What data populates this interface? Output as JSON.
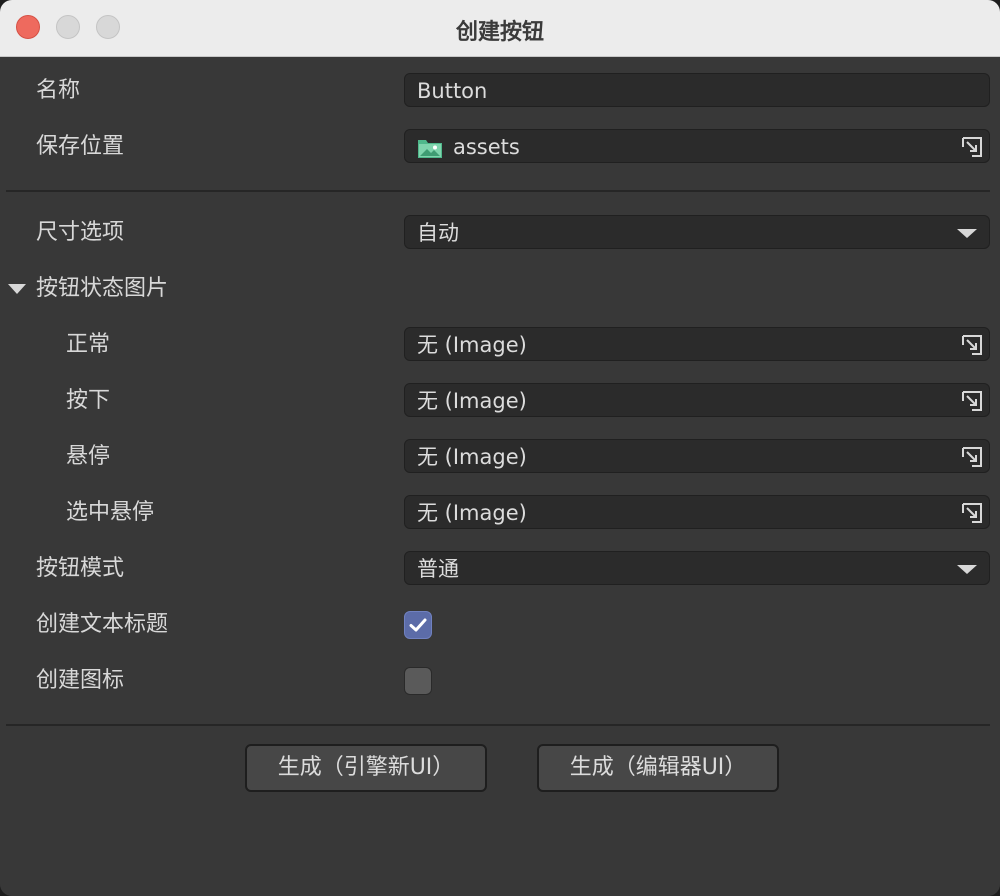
{
  "window": {
    "title": "创建按钮"
  },
  "form": {
    "name": {
      "label": "名称",
      "value": "Button"
    },
    "save_location": {
      "label": "保存位置",
      "value": "assets",
      "icon": "folder-icon"
    },
    "size_option": {
      "label": "尺寸选项",
      "value": "自动"
    },
    "state_images": {
      "label": "按钮状态图片",
      "normal": {
        "label": "正常",
        "value": "无 (Image)"
      },
      "pressed": {
        "label": "按下",
        "value": "无 (Image)"
      },
      "hover": {
        "label": "悬停",
        "value": "无 (Image)"
      },
      "selected_hover": {
        "label": "选中悬停",
        "value": "无 (Image)"
      }
    },
    "button_mode": {
      "label": "按钮模式",
      "value": "普通"
    },
    "create_text_title": {
      "label": "创建文本标题",
      "checked": true
    },
    "create_icon": {
      "label": "创建图标",
      "checked": false
    }
  },
  "actions": {
    "generate_engine_ui": "生成（引擎新UI）",
    "generate_editor_ui": "生成（编辑器UI）"
  },
  "colors": {
    "accent": "#5c6ca8",
    "folder": "#4fb88b"
  }
}
